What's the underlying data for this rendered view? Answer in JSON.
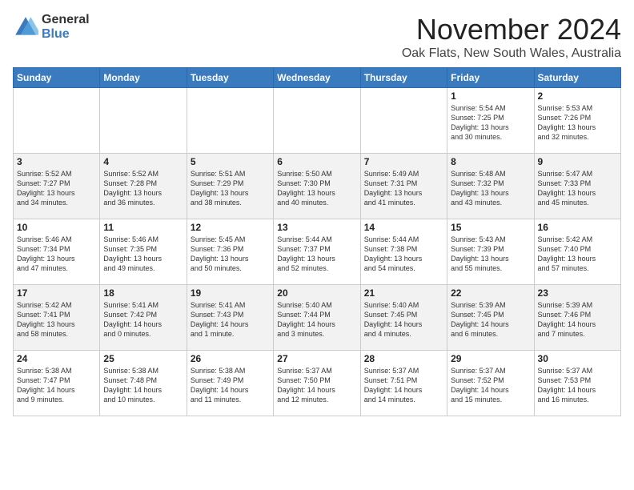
{
  "logo": {
    "general": "General",
    "blue": "Blue"
  },
  "header": {
    "month": "November 2024",
    "location": "Oak Flats, New South Wales, Australia"
  },
  "weekdays": [
    "Sunday",
    "Monday",
    "Tuesday",
    "Wednesday",
    "Thursday",
    "Friday",
    "Saturday"
  ],
  "weeks": [
    [
      {
        "day": "",
        "info": ""
      },
      {
        "day": "",
        "info": ""
      },
      {
        "day": "",
        "info": ""
      },
      {
        "day": "",
        "info": ""
      },
      {
        "day": "",
        "info": ""
      },
      {
        "day": "1",
        "info": "Sunrise: 5:54 AM\nSunset: 7:25 PM\nDaylight: 13 hours\nand 30 minutes."
      },
      {
        "day": "2",
        "info": "Sunrise: 5:53 AM\nSunset: 7:26 PM\nDaylight: 13 hours\nand 32 minutes."
      }
    ],
    [
      {
        "day": "3",
        "info": "Sunrise: 5:52 AM\nSunset: 7:27 PM\nDaylight: 13 hours\nand 34 minutes."
      },
      {
        "day": "4",
        "info": "Sunrise: 5:52 AM\nSunset: 7:28 PM\nDaylight: 13 hours\nand 36 minutes."
      },
      {
        "day": "5",
        "info": "Sunrise: 5:51 AM\nSunset: 7:29 PM\nDaylight: 13 hours\nand 38 minutes."
      },
      {
        "day": "6",
        "info": "Sunrise: 5:50 AM\nSunset: 7:30 PM\nDaylight: 13 hours\nand 40 minutes."
      },
      {
        "day": "7",
        "info": "Sunrise: 5:49 AM\nSunset: 7:31 PM\nDaylight: 13 hours\nand 41 minutes."
      },
      {
        "day": "8",
        "info": "Sunrise: 5:48 AM\nSunset: 7:32 PM\nDaylight: 13 hours\nand 43 minutes."
      },
      {
        "day": "9",
        "info": "Sunrise: 5:47 AM\nSunset: 7:33 PM\nDaylight: 13 hours\nand 45 minutes."
      }
    ],
    [
      {
        "day": "10",
        "info": "Sunrise: 5:46 AM\nSunset: 7:34 PM\nDaylight: 13 hours\nand 47 minutes."
      },
      {
        "day": "11",
        "info": "Sunrise: 5:46 AM\nSunset: 7:35 PM\nDaylight: 13 hours\nand 49 minutes."
      },
      {
        "day": "12",
        "info": "Sunrise: 5:45 AM\nSunset: 7:36 PM\nDaylight: 13 hours\nand 50 minutes."
      },
      {
        "day": "13",
        "info": "Sunrise: 5:44 AM\nSunset: 7:37 PM\nDaylight: 13 hours\nand 52 minutes."
      },
      {
        "day": "14",
        "info": "Sunrise: 5:44 AM\nSunset: 7:38 PM\nDaylight: 13 hours\nand 54 minutes."
      },
      {
        "day": "15",
        "info": "Sunrise: 5:43 AM\nSunset: 7:39 PM\nDaylight: 13 hours\nand 55 minutes."
      },
      {
        "day": "16",
        "info": "Sunrise: 5:42 AM\nSunset: 7:40 PM\nDaylight: 13 hours\nand 57 minutes."
      }
    ],
    [
      {
        "day": "17",
        "info": "Sunrise: 5:42 AM\nSunset: 7:41 PM\nDaylight: 13 hours\nand 58 minutes."
      },
      {
        "day": "18",
        "info": "Sunrise: 5:41 AM\nSunset: 7:42 PM\nDaylight: 14 hours\nand 0 minutes."
      },
      {
        "day": "19",
        "info": "Sunrise: 5:41 AM\nSunset: 7:43 PM\nDaylight: 14 hours\nand 1 minute."
      },
      {
        "day": "20",
        "info": "Sunrise: 5:40 AM\nSunset: 7:44 PM\nDaylight: 14 hours\nand 3 minutes."
      },
      {
        "day": "21",
        "info": "Sunrise: 5:40 AM\nSunset: 7:45 PM\nDaylight: 14 hours\nand 4 minutes."
      },
      {
        "day": "22",
        "info": "Sunrise: 5:39 AM\nSunset: 7:45 PM\nDaylight: 14 hours\nand 6 minutes."
      },
      {
        "day": "23",
        "info": "Sunrise: 5:39 AM\nSunset: 7:46 PM\nDaylight: 14 hours\nand 7 minutes."
      }
    ],
    [
      {
        "day": "24",
        "info": "Sunrise: 5:38 AM\nSunset: 7:47 PM\nDaylight: 14 hours\nand 9 minutes."
      },
      {
        "day": "25",
        "info": "Sunrise: 5:38 AM\nSunset: 7:48 PM\nDaylight: 14 hours\nand 10 minutes."
      },
      {
        "day": "26",
        "info": "Sunrise: 5:38 AM\nSunset: 7:49 PM\nDaylight: 14 hours\nand 11 minutes."
      },
      {
        "day": "27",
        "info": "Sunrise: 5:37 AM\nSunset: 7:50 PM\nDaylight: 14 hours\nand 12 minutes."
      },
      {
        "day": "28",
        "info": "Sunrise: 5:37 AM\nSunset: 7:51 PM\nDaylight: 14 hours\nand 14 minutes."
      },
      {
        "day": "29",
        "info": "Sunrise: 5:37 AM\nSunset: 7:52 PM\nDaylight: 14 hours\nand 15 minutes."
      },
      {
        "day": "30",
        "info": "Sunrise: 5:37 AM\nSunset: 7:53 PM\nDaylight: 14 hours\nand 16 minutes."
      }
    ]
  ]
}
